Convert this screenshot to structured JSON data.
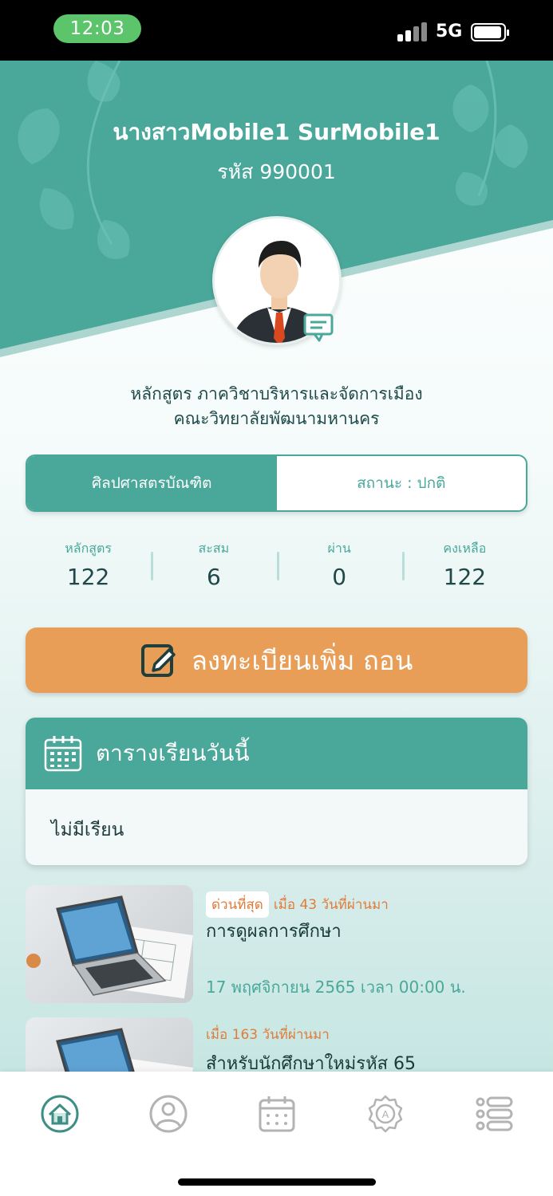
{
  "status_bar": {
    "time": "12:03",
    "network": "5G"
  },
  "profile": {
    "name": "นางสาวMobile1 SurMobile1",
    "code": "รหัส 990001",
    "program_line1": "หลักสูตร ภาควิชาบริหารและจัดการเมือง",
    "program_line2": "คณะวิทยาลัยพัฒนามหานคร"
  },
  "tabs": {
    "degree": "ศิลปศาสตรบัณฑิต",
    "status": "สถานะ : ปกติ"
  },
  "stats": [
    {
      "label": "หลักสูตร",
      "value": "122"
    },
    {
      "label": "สะสม",
      "value": "6"
    },
    {
      "label": "ผ่าน",
      "value": "0"
    },
    {
      "label": "คงเหลือ",
      "value": "122"
    }
  ],
  "register_button": {
    "label": "ลงทะเบียนเพิ่ม ถอน"
  },
  "schedule": {
    "title": "ตารางเรียนวันนี้",
    "empty_text": "ไม่มีเรียน"
  },
  "news": [
    {
      "badge": "ด่วนที่สุด",
      "time_ago": "เมื่อ 43 วันที่ผ่านมา",
      "title": "การดูผลการศึกษา",
      "date": "17 พฤศจิกายน 2565 เวลา 00:00 น."
    },
    {
      "badge": "",
      "time_ago": "เมื่อ 163 วันที่ผ่านมา",
      "title": "สำหรับนักศึกษาใหม่รหัส 65",
      "date": ""
    }
  ],
  "nav": [
    "home-icon",
    "profile-icon",
    "calendar-icon",
    "certificate-icon",
    "menu-list-icon"
  ],
  "colors": {
    "primary": "#4aa89b",
    "accent": "#e89e57",
    "urgent": "#e07b3a"
  }
}
